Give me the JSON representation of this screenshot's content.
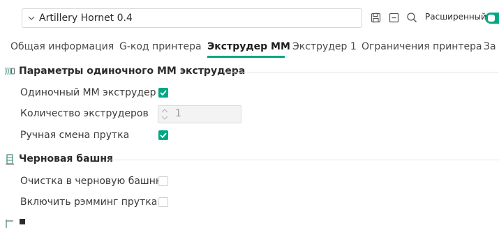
{
  "header": {
    "preset_name": "Artillery Hornet 0.4",
    "advanced_label": "Расширенный",
    "advanced_enabled": true,
    "accent_color": "#00a884"
  },
  "tabs": [
    {
      "label": "Общая информация",
      "active": false
    },
    {
      "label": "G-код принтера",
      "active": false
    },
    {
      "label": "Экструдер ММ",
      "active": true
    },
    {
      "label": "Экструдер 1",
      "active": false
    },
    {
      "label": "Ограничения принтера",
      "active": false
    },
    {
      "label": "За",
      "active": false
    }
  ],
  "sections": [
    {
      "title": "Параметры одиночного ММ экструдера",
      "icon": "extruder-icon",
      "options": [
        {
          "label": "Одиночный ММ экструдер",
          "type": "checkbox",
          "checked": true
        },
        {
          "label": "Количество экструдеров",
          "type": "spinner",
          "value": "1",
          "disabled": true
        },
        {
          "label": "Ручная смена прутка",
          "type": "checkbox",
          "checked": true
        }
      ]
    },
    {
      "title": "Черновая башня",
      "icon": "prime-tower-icon",
      "options": [
        {
          "label": "Очистка в черновую башню",
          "type": "checkbox",
          "checked": false
        },
        {
          "label": "Включить рэмминг прутка",
          "type": "checkbox",
          "checked": false
        }
      ]
    }
  ]
}
